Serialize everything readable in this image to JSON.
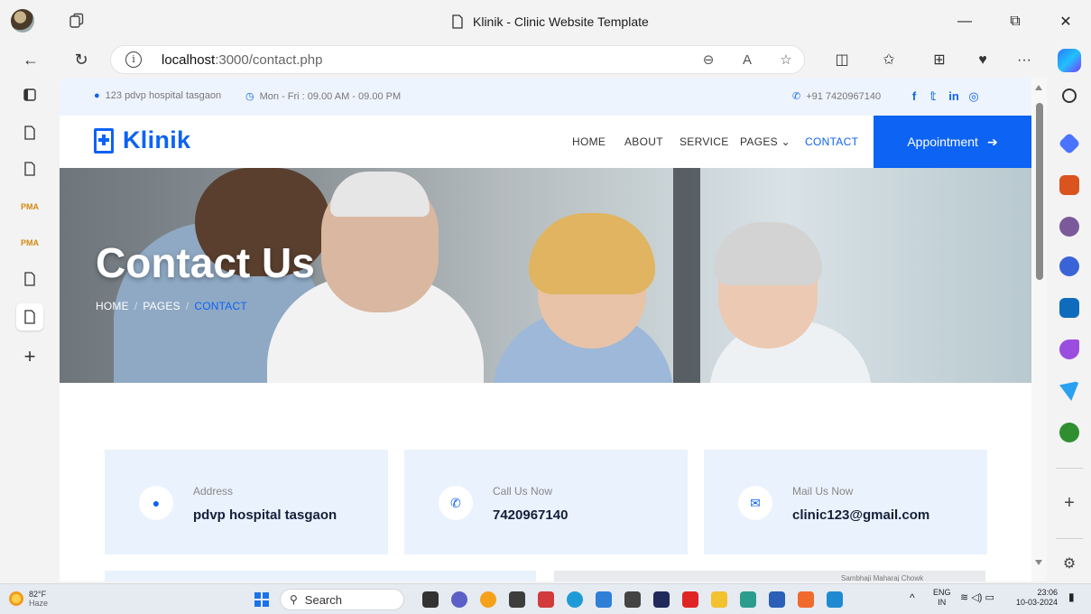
{
  "browser": {
    "tab_title": "Klinik - Clinic Website Template",
    "url_host": "localhost",
    "url_rest": ":3000/contact.php",
    "window_min": "—",
    "window_restore": "⧉",
    "window_close": "✕",
    "more_label": "···"
  },
  "left_tabs": {
    "pma_label": "PMA"
  },
  "site": {
    "topbar": {
      "address": "123 pdvp hospital tasgaon",
      "hours": "Mon - Fri : 09.00 AM - 09.00 PM",
      "phone": "+91 7420967140",
      "social": [
        "f",
        "𝕥",
        "in",
        "◎"
      ]
    },
    "brand": "Klinik",
    "menu": [
      "HOME",
      "ABOUT",
      "SERVICE",
      "PAGES ⌄",
      "CONTACT"
    ],
    "appointment_label": "Appointment",
    "hero": {
      "title": "Contact Us",
      "breadcrumb": [
        "HOME",
        "PAGES",
        "CONTACT"
      ],
      "breadcrumb_sep": "/"
    },
    "cards": [
      {
        "label": "Address",
        "value": "pdvp hospital tasgaon",
        "icon": "map-marker-icon"
      },
      {
        "label": "Call Us Now",
        "value": "7420967140",
        "icon": "phone-icon"
      },
      {
        "label": "Mail Us Now",
        "value": "clinic123@gmail.com",
        "icon": "mail-icon"
      }
    ],
    "map_snippet": "Sambhaji Maharaj Chowk"
  },
  "taskbar": {
    "temperature": "82°F",
    "weather": "Haze",
    "search_placeholder": "Search",
    "lang_top": "ENG",
    "lang_bottom": "IN",
    "time": "23:06",
    "date": "10-03-2024"
  },
  "colors": {
    "brand_blue": "#0d63f3",
    "card_bg": "#eaf2fd",
    "topbar_bg": "#eef4fd"
  }
}
